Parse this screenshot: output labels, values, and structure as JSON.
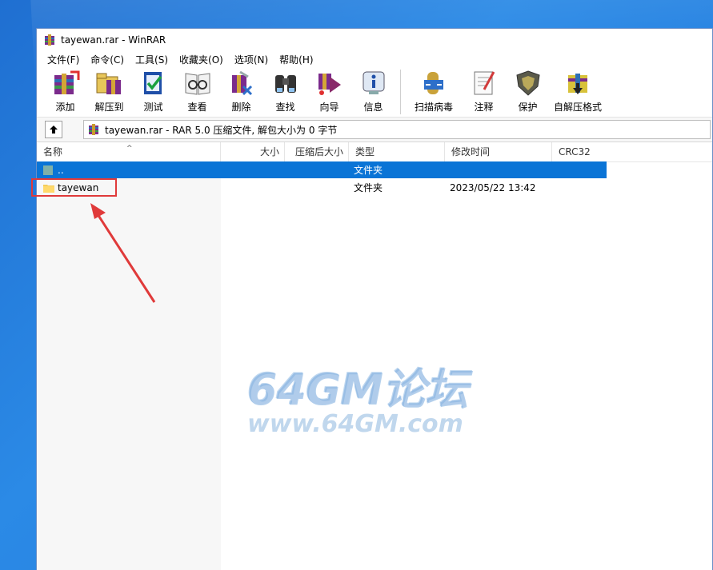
{
  "window": {
    "title": "tayewan.rar - WinRAR"
  },
  "menu": [
    {
      "label": "文件(F)"
    },
    {
      "label": "命令(C)"
    },
    {
      "label": "工具(S)"
    },
    {
      "label": "收藏夹(O)"
    },
    {
      "label": "选项(N)"
    },
    {
      "label": "帮助(H)"
    }
  ],
  "toolbar": [
    {
      "label": "添加",
      "icon": "add-icon"
    },
    {
      "label": "解压到",
      "icon": "extract-to-icon"
    },
    {
      "label": "测试",
      "icon": "test-icon"
    },
    {
      "label": "查看",
      "icon": "view-icon"
    },
    {
      "label": "删除",
      "icon": "delete-icon"
    },
    {
      "label": "查找",
      "icon": "find-icon"
    },
    {
      "label": "向导",
      "icon": "wizard-icon"
    },
    {
      "label": "信息",
      "icon": "info-icon"
    },
    {
      "label": "扫描病毒",
      "icon": "virus-scan-icon"
    },
    {
      "label": "注释",
      "icon": "comment-icon"
    },
    {
      "label": "保护",
      "icon": "protect-icon"
    },
    {
      "label": "自解压格式",
      "icon": "sfx-icon"
    }
  ],
  "address": {
    "text": "tayewan.rar - RAR 5.0 压缩文件, 解包大小为 0 字节"
  },
  "columns": {
    "name": "名称",
    "size": "大小",
    "packed": "压缩后大小",
    "type": "类型",
    "modified": "修改时间",
    "crc": "CRC32"
  },
  "rows": [
    {
      "name": "..",
      "size": "",
      "packed": "",
      "type": "文件夹",
      "modified": "",
      "crc": "",
      "selected": true
    },
    {
      "name": "tayewan",
      "size": "",
      "packed": "",
      "type": "文件夹",
      "modified": "2023/05/22 13:42",
      "crc": "",
      "selected": false
    }
  ],
  "watermark": {
    "line1": "64GM论坛",
    "line2": "www.64GM.com"
  },
  "colors": {
    "selection": "#0a74d6",
    "highlight": "#e03a3a",
    "desktop": "#2b8ae6"
  }
}
